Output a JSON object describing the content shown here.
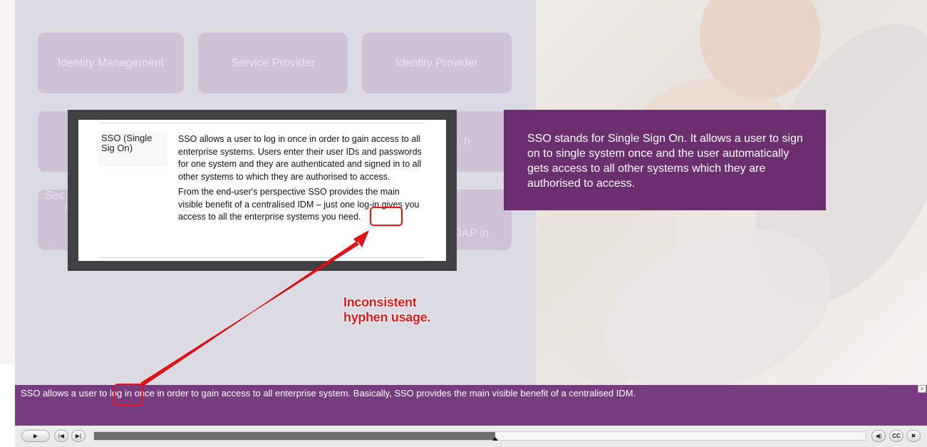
{
  "tiles": {
    "identity_management": "Identity Management",
    "service_provider": "Service Provider",
    "identity_provider": "Identity Provider",
    "partial_h": "h",
    "partial_sec": "Sec",
    "partial_sec2": "I",
    "partial_ldap": "DAP in",
    "partial_ldap2": "-"
  },
  "popup": {
    "term": "SSO (Single Sig On)",
    "definition_p1": "SSO allows a user to log in once in order to gain access to all enterprise systems. Users enter their user IDs and passwords for one system and they are authenticated and signed in to all other systems to which they are authorised to access.",
    "definition_p2": "From the end-user's perspective SSO provides the main visible benefit of a centralised IDM – just one log-in gives you access to all the enterprise systems you need."
  },
  "callout": {
    "text": "SSO stands for Single Sign On. It allows a user to sign on to single system once and the user automatically gets access to all other systems which they are authorised to access."
  },
  "annotation": {
    "line1": "Inconsistent",
    "line2": "hyphen usage."
  },
  "caption": {
    "text": "SSO allows a user to log in once in order to gain access to all enterprise system. Basically, SSO provides the main visible benefit of a centralised IDM.",
    "close": "×"
  },
  "controls": {
    "play": "▶",
    "prev": "|◀",
    "next": "▶|",
    "audio": "◀)",
    "cc": "CC",
    "close": "✖",
    "progress": 0.52
  },
  "colors": {
    "annotation_red": "#e8141a",
    "callout_purple": "#6b2e6f",
    "caption_purple": "#773c80"
  }
}
